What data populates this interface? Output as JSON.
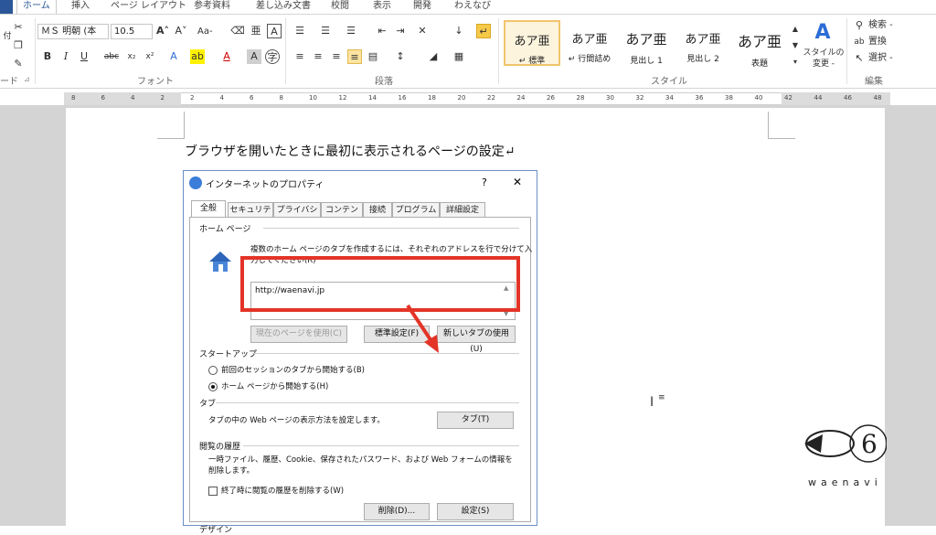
{
  "ribbon_tabs": [
    "ホーム",
    "挿入",
    "ページ レイアウト",
    "参考資料",
    "差し込み文書",
    "校閲",
    "表示",
    "開発",
    "わえなび"
  ],
  "ribbon": {
    "font_name": "ＭＳ 明朝 (本",
    "font_size": "10.5",
    "font_group_label": "フォント",
    "paragraph_group_label": "段落",
    "styles_group_label": "スタイル",
    "edit_group_label": "編集",
    "clipboard_group_label": "ード",
    "styles": [
      {
        "preview": "あア亜",
        "name": "↵ 標準"
      },
      {
        "preview": "あア亜",
        "name": "↵ 行間詰め"
      },
      {
        "preview": "あア亜",
        "name": "見出し 1"
      },
      {
        "preview": "あア亜",
        "name": "見出し 2"
      },
      {
        "preview": "あア亜",
        "name": "表題"
      }
    ],
    "change_styles_label": "スタイルの変更 -",
    "find_label": "検索 -",
    "replace_label": "置換",
    "select_label": "選択 -",
    "bold": "B",
    "italic": "I",
    "underline": "U",
    "aa_label": "Aa-",
    "strike": "abc"
  },
  "ruler": {
    "numbers": [
      "8",
      "6",
      "4",
      "2",
      "2",
      "4",
      "6",
      "8",
      "10",
      "12",
      "14",
      "16",
      "18",
      "20",
      "22",
      "24",
      "26",
      "28",
      "30",
      "32",
      "34",
      "36",
      "38",
      "40",
      "42",
      "44",
      "46",
      "48"
    ]
  },
  "document": {
    "heading_text": "ブラウザを開いたときに最初に表示されるページの設定↵"
  },
  "dialog": {
    "title": "インターネットのプロパティ",
    "help": "?",
    "close": "✕",
    "tabs": [
      "全般",
      "セキュリティ",
      "プライバシー",
      "コンテンツ",
      "接続",
      "プログラム",
      "詳細設定"
    ],
    "home_section": "ホーム ページ",
    "home_desc_1": "複数のホーム ページのタブを作成するには、それぞれのアドレスを行で分けて入",
    "home_desc_2": "力してください(R)",
    "home_url": "http://waenavi.jp",
    "btn_current": "現在のページを使用(C)",
    "btn_default": "標準設定(F)",
    "btn_newtab": "新しいタブの使用(U)",
    "startup_section": "スタートアップ",
    "radio_last_session": "前回のセッションのタブから開始する(B)",
    "radio_home": "ホーム ページから開始する(H)",
    "tab_section": "タブ",
    "tab_desc": "タブの中の Web ページの表示方法を設定します。",
    "btn_tabs": "タブ(T)",
    "history_section": "閲覧の履歴",
    "history_desc_1": "一時ファイル、履歴、Cookie、保存されたパスワード、および Web フォームの情報を",
    "history_desc_2": "削除します。",
    "checkbox_delete_on_exit": "終了時に閲覧の履歴を削除する(W)",
    "btn_delete": "削除(D)...",
    "btn_settings": "設定(S)",
    "design_section": "デザイン"
  },
  "watermark": {
    "text": "waenavi",
    "mark": "6"
  },
  "colors": {
    "highlight": "#e33427",
    "accent": "#2b579a"
  }
}
